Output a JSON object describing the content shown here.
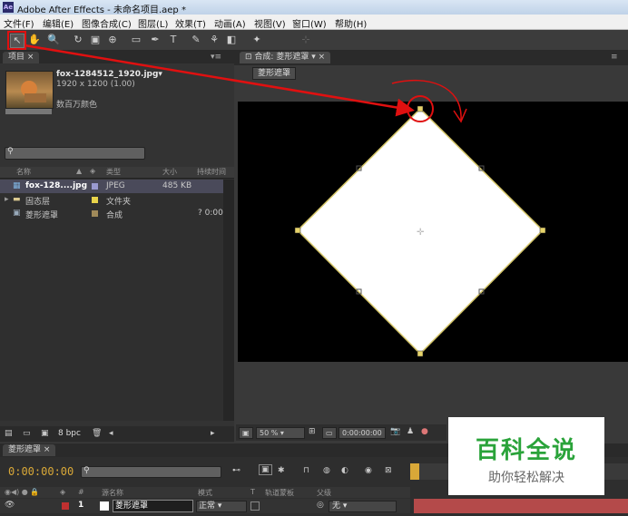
{
  "window": {
    "title": "Adobe After Effects - 未命名项目.aep *",
    "logo": "Ae"
  },
  "menu": [
    "文件(F)",
    "编辑(E)",
    "图像合成(C)",
    "图层(L)",
    "效果(T)",
    "动画(A)",
    "视图(V)",
    "窗口(W)",
    "帮助(H)"
  ],
  "project": {
    "tab": "项目",
    "item_name": "fox-1284512_1920.jpg▾",
    "item_dims": "1920 x 1200 (1.00)",
    "item_color": "数百万颜色",
    "columns": [
      "名称",
      "类型",
      "大小",
      "持续时间"
    ],
    "rows": [
      {
        "name": "fox-128....jpg",
        "type": "JPEG",
        "size": "485 KB",
        "dur": "",
        "swatch": "#9a9ad0"
      },
      {
        "name": "固态层",
        "type": "文件夹",
        "size": "",
        "dur": "",
        "swatch": "#e8d34a"
      },
      {
        "name": "菱形遮罩",
        "type": "合成",
        "size": "",
        "dur": "? 0:00",
        "swatch": "#a08a5a"
      }
    ],
    "bpc": "8 bpc"
  },
  "comp": {
    "tab": "合成: 菱形遮罩",
    "crumb": "菱形遮罩",
    "zoom": "50 %",
    "timecode": "0:00:00:00"
  },
  "timeline": {
    "tab": "菱形遮罩",
    "timecode": "0:00:00:00",
    "columns": [
      "源名称",
      "模式",
      "T",
      "轨道蒙板",
      "父级"
    ],
    "layer": {
      "num": "1",
      "name": "菱形遮罩",
      "mode": "正常",
      "parent": "无"
    }
  },
  "watermark": {
    "big": "百科全说",
    "small": "助你轻松解决"
  },
  "colors": {
    "annotation": "#e01010",
    "handle": "#e6d36a",
    "watermark_green": "#2aa33a"
  }
}
